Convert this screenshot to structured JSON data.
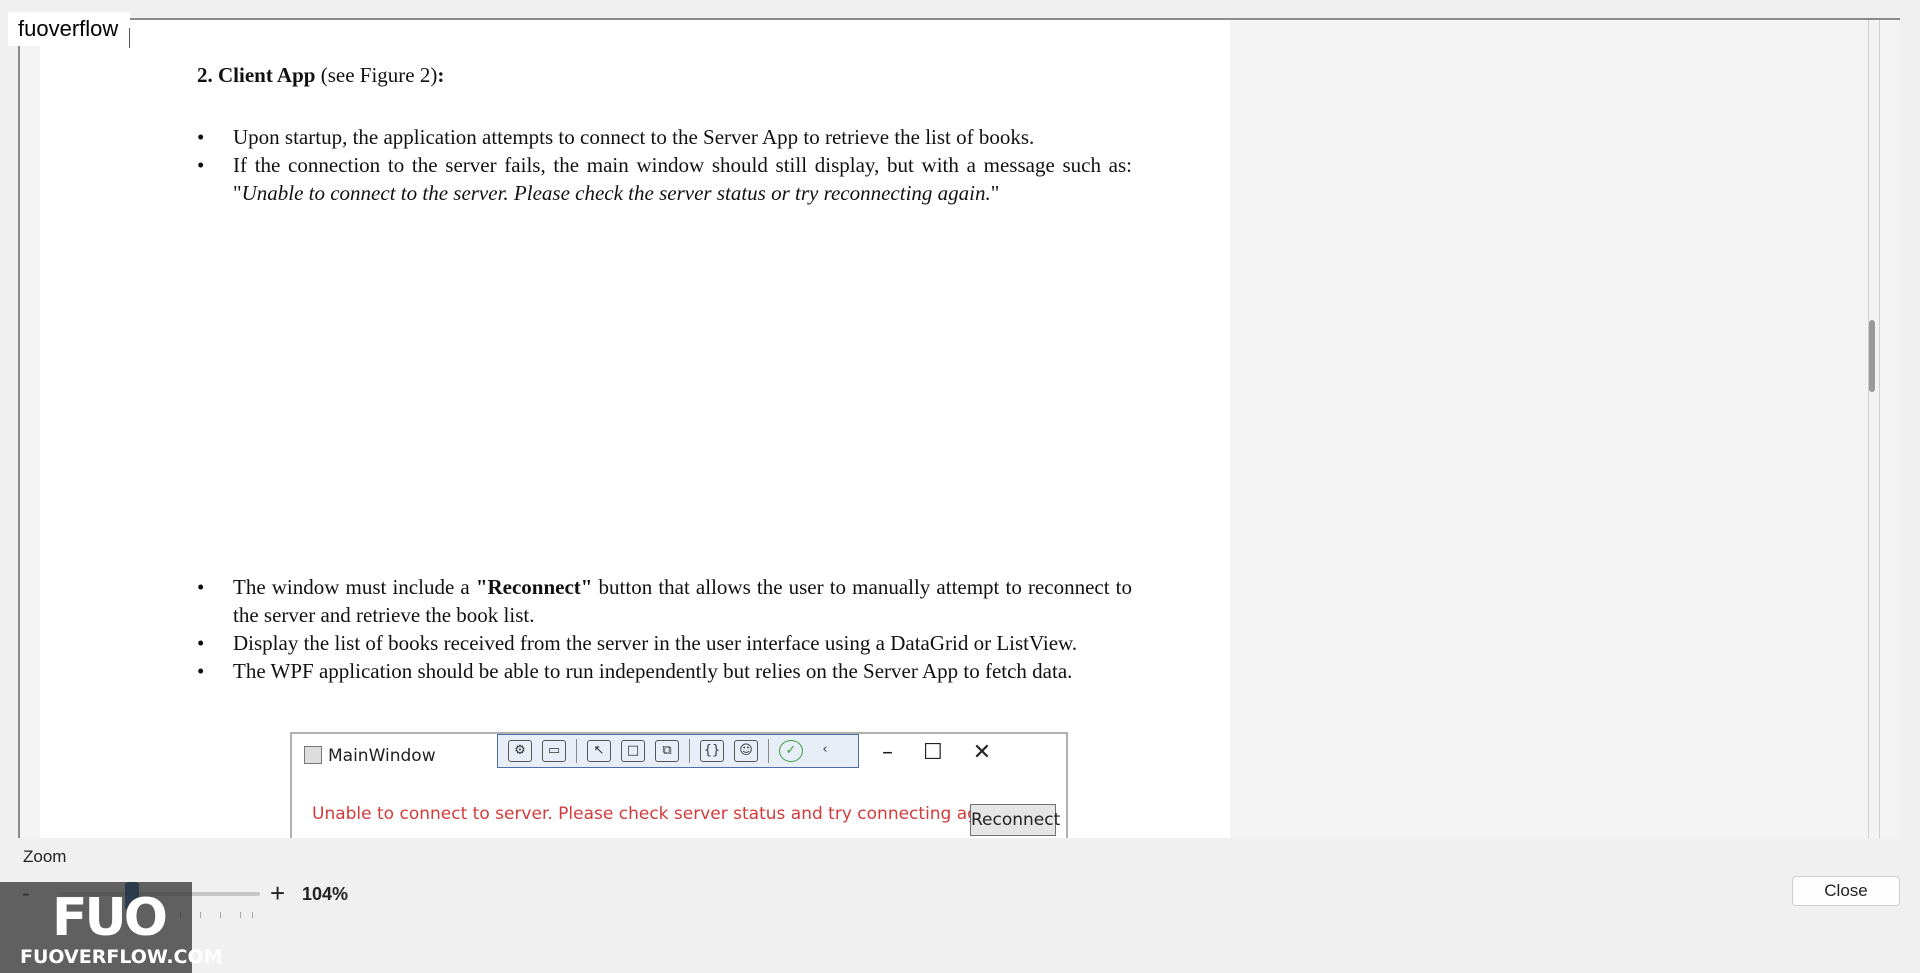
{
  "app": {
    "tab_label": "fuoverflow"
  },
  "document": {
    "heading_bold": "2. Client App",
    "heading_rest": " (see Figure 2)",
    "heading_colon": ":",
    "bullets_a": [
      {
        "text": "Upon startup, the application attempts to connect to the Server App to retrieve the list of books."
      },
      {
        "text": "If the connection to the server fails, the main window should still display, but with a message such as: \"",
        "italic": "Unable to connect to the server. Please check the server status or try reconnecting again.",
        "tail": "\""
      }
    ],
    "bullets_b": [
      {
        "pre": "The window must include a ",
        "bold": "\"Reconnect\"",
        "post": " button that allows the user to manually attempt to reconnect to the server and retrieve the book list."
      },
      {
        "text": "Display the list of books received from the server in the user interface using a DataGrid or ListView."
      },
      {
        "text": "The WPF application should be able to run independently but relies on the Server App to fetch data."
      }
    ]
  },
  "figure": {
    "window_title": "MainWindow",
    "message": "Unable to connect to server. Please check server status and try connecting again.",
    "message_color": "#d33b3b",
    "button_label": "Reconnect",
    "controls": {
      "minimize": "–",
      "maximize": "☐",
      "close": "✕"
    }
  },
  "footer": {
    "zoom_label": "Zoom",
    "zoom_minus": "-",
    "zoom_plus": "+",
    "zoom_value": "104%",
    "zoom_level": 0.35,
    "close_label": "Close"
  },
  "watermark": {
    "logo": "FUO",
    "text": "FUOVERFLOW.COM"
  }
}
